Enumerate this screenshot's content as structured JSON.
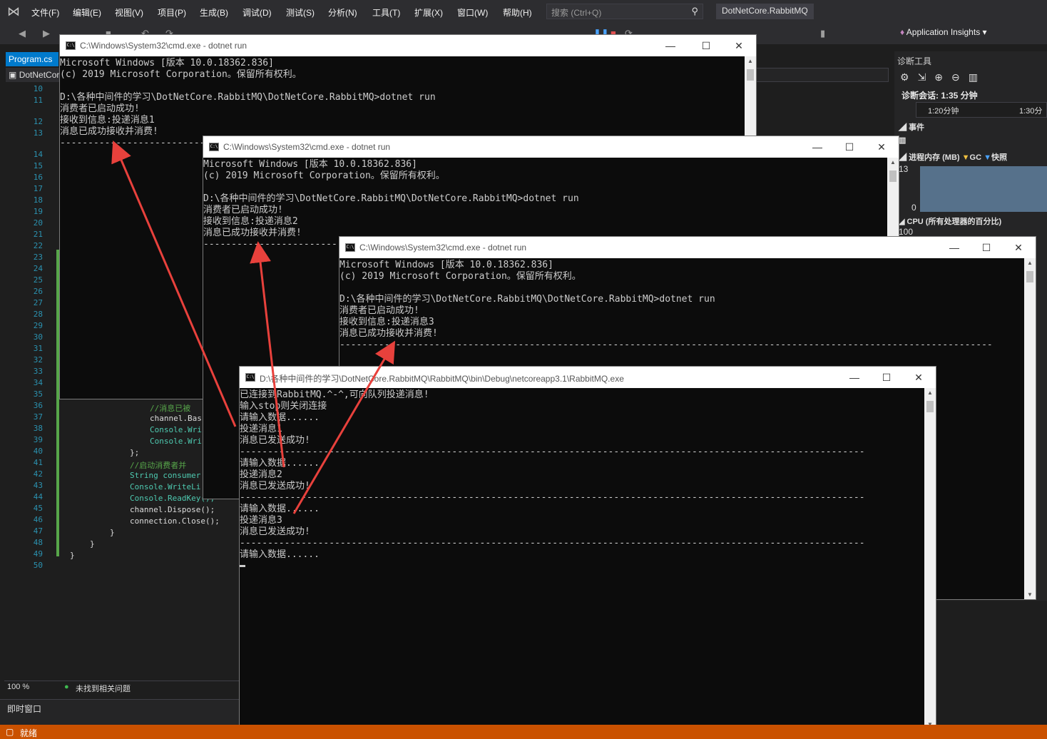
{
  "vs": {
    "menu": [
      "文件(F)",
      "编辑(E)",
      "视图(V)",
      "项目(P)",
      "生成(B)",
      "调试(D)",
      "测试(S)",
      "分析(N)",
      "工具(T)",
      "扩展(X)",
      "窗口(W)",
      "帮助(H)"
    ],
    "search_placeholder": "搜索 (Ctrl+Q)",
    "solution_name": "DotNetCore.RabbitMQ",
    "app_insights": "Application Insights ▾",
    "doc_tab": "Program.cs",
    "nav_project": "DotNetCore",
    "line_numbers": [
      "10",
      "11",
      "12",
      "13",
      "14",
      "15",
      "16",
      "17",
      "18",
      "19",
      "20",
      "21",
      "22",
      "23",
      "24",
      "25",
      "26",
      "27",
      "28",
      "29",
      "30",
      "31",
      "32",
      "33",
      "34",
      "35",
      "36",
      "37",
      "38",
      "39",
      "40",
      "41",
      "42",
      "43",
      "44",
      "45",
      "46",
      "47",
      "48",
      "49",
      "50"
    ],
    "code_visible": [
      {
        "text": "//消息已被",
        "color": "#57a64a"
      },
      {
        "text": "channel.Bas",
        "color": "#dcdcdc"
      },
      {
        "text": "Console.Wri",
        "color": "#4ec9b0"
      },
      {
        "text": "Console.Wri",
        "color": "#4ec9b0"
      },
      {
        "text": "};",
        "color": "#dcdcdc"
      },
      {
        "text": "//启动消费者并",
        "color": "#57a64a"
      },
      {
        "text": "String consumer",
        "color": "#4ec9b0"
      },
      {
        "text": "Console.WriteLi",
        "color": "#4ec9b0"
      },
      {
        "text": "Console.ReadKey();",
        "color": "#4ec9b0"
      },
      {
        "text": "channel.Dispose();",
        "color": "#dcdcdc"
      },
      {
        "text": "connection.Close();",
        "color": "#dcdcdc"
      },
      {
        "text": "}",
        "color": "#dcdcdc"
      },
      {
        "text": "}",
        "color": "#dcdcdc"
      },
      {
        "text": "}",
        "color": "#dcdcdc"
      }
    ],
    "zoom": "100 %",
    "issues_text": "未找到相关问题",
    "immediate_window": "即时窗口",
    "diag": {
      "title": "诊断工具",
      "session": "诊断会话: 1:35 分钟",
      "ruler_1": "1:20分钟",
      "ruler_2": "1:30分",
      "events": "事件",
      "memory": "进程内存 (MB)",
      "gc": "GC",
      "snapshot": "快照",
      "mem_max": "13",
      "mem_min": "0",
      "cpu": "CPU (所有处理器的百分比)",
      "cpu_max": "100"
    },
    "status": "就绪",
    "accent": "#007acc",
    "status_color": "#ca5100"
  },
  "consoles": [
    {
      "title": "C:\\Windows\\System32\\cmd.exe - dotnet  run",
      "lines": [
        "Microsoft Windows [版本 10.0.18362.836]",
        "(c) 2019 Microsoft Corporation。保留所有权利。",
        "",
        "D:\\各种中间件的学习\\DotNetCore.RabbitMQ\\DotNetCore.RabbitMQ>dotnet run",
        "消费者已启动成功!",
        "接收到信息:投递消息1",
        "消息已成功接收并消费!",
        "---------------------------------------------------------------------------------------------"
      ]
    },
    {
      "title": "C:\\Windows\\System32\\cmd.exe - dotnet  run",
      "lines": [
        "Microsoft Windows [版本 10.0.18362.836]",
        "(c) 2019 Microsoft Corporation。保留所有权利。",
        "",
        "D:\\各种中间件的学习\\DotNetCore.RabbitMQ\\DotNetCore.RabbitMQ>dotnet run",
        "消费者已启动成功!",
        "接收到信息:投递消息2",
        "消息已成功接收并消费!",
        "---------------------------------------------------------------------------------------------"
      ]
    },
    {
      "title": "C:\\Windows\\System32\\cmd.exe - dotnet  run",
      "lines": [
        "Microsoft Windows [版本 10.0.18362.836]",
        "(c) 2019 Microsoft Corporation。保留所有权利。",
        "",
        "D:\\各种中间件的学习\\DotNetCore.RabbitMQ\\DotNetCore.RabbitMQ>dotnet run",
        "消费者已启动成功!",
        "接收到信息:投递消息3",
        "消息已成功接收并消费!",
        "---------------------------------------------------------------------------------------------------------------------"
      ]
    },
    {
      "title": "D:\\各种中间件的学习\\DotNetCore.RabbitMQ\\RabbitMQ\\bin\\Debug\\netcoreapp3.1\\RabbitMQ.exe",
      "lines": [
        "已连接到RabbitMQ.^-^,可向队列投递消息!",
        "输入stop则关闭连接",
        "请输入数据......",
        "投递消息1",
        "消息已发送成功!",
        "----------------------------------------------------------------------------------------------------------------",
        "请输入数据......",
        "投递消息2",
        "消息已发送成功!",
        "----------------------------------------------------------------------------------------------------------------",
        "请输入数据......",
        "投递消息3",
        "消息已发送成功!",
        "----------------------------------------------------------------------------------------------------------------",
        "请输入数据......"
      ]
    }
  ],
  "window_buttons": {
    "minimize": "—",
    "maximize": "☐",
    "close": "✕"
  },
  "annotation_color": "#e8413c"
}
